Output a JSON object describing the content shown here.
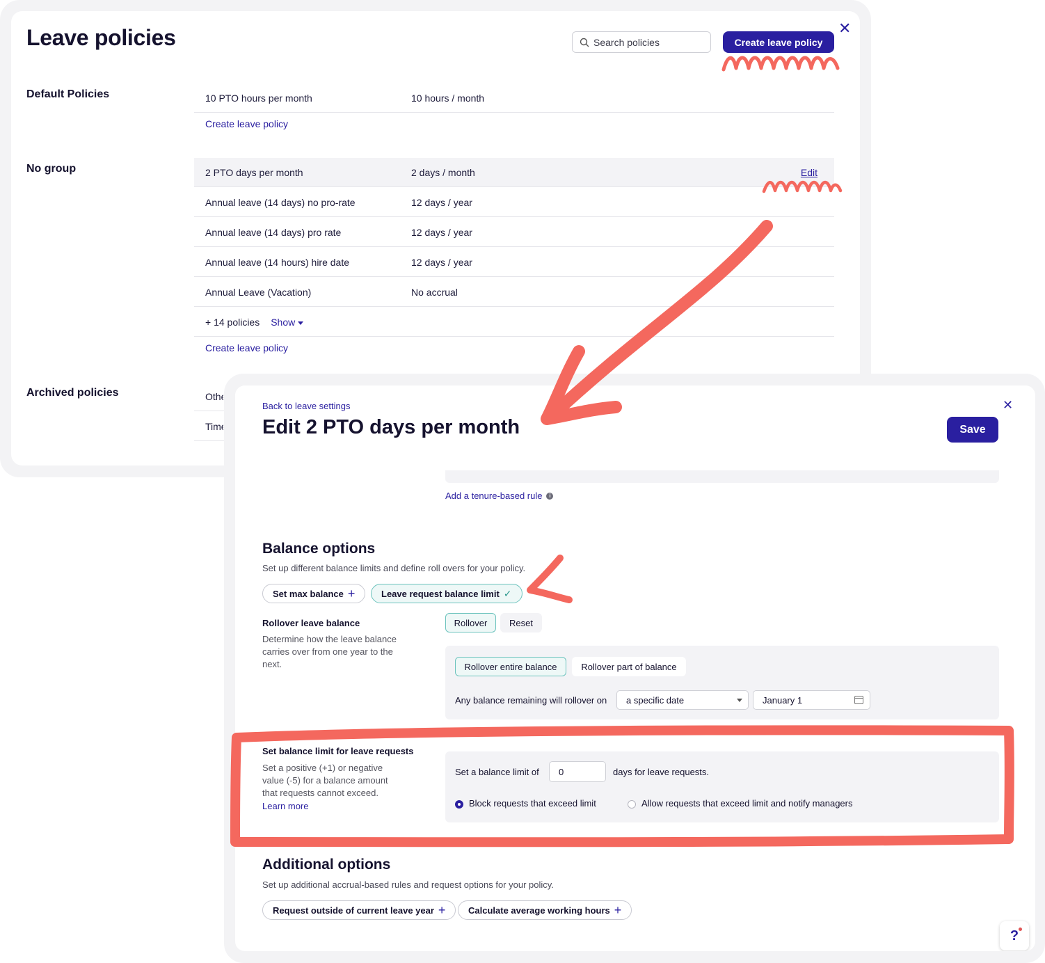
{
  "back_panel": {
    "title": "Leave policies",
    "search": {
      "placeholder": "Search policies"
    },
    "create_button": "Create leave policy",
    "sections": {
      "default": {
        "label": "Default Policies",
        "rows": [
          {
            "name": "10 PTO hours per month",
            "value": "10 hours / month"
          }
        ],
        "create_link": "Create leave policy"
      },
      "no_group": {
        "label": "No group",
        "rows": [
          {
            "name": "2 PTO days per month",
            "value": "2 days / month",
            "action": "Edit"
          },
          {
            "name": "Annual leave (14 days) no pro-rate",
            "value": "12 days / year"
          },
          {
            "name": "Annual leave (14 days) pro rate",
            "value": "12 days / year"
          },
          {
            "name": "Annual leave (14 hours) hire date",
            "value": "12 days / year"
          },
          {
            "name": "Annual Leave (Vacation)",
            "value": "No accrual"
          }
        ],
        "more_count": "+ 14 policies",
        "show_label": "Show",
        "create_link": "Create leave policy"
      },
      "archived": {
        "label": "Archived policies",
        "rows": [
          {
            "name": "Othe"
          },
          {
            "name": "Time"
          }
        ]
      }
    }
  },
  "front_panel": {
    "back_link": "Back to leave settings",
    "title": "Edit 2 PTO days per month",
    "save_button": "Save",
    "tenure_link": "Add a tenure-based rule",
    "balance_options": {
      "heading": "Balance options",
      "description": "Set up different balance limits and define roll overs for your policy.",
      "chips": [
        {
          "label": "Set max balance",
          "state": "add"
        },
        {
          "label": "Leave request balance limit",
          "state": "selected"
        }
      ],
      "rollover": {
        "title": "Rollover leave balance",
        "description": "Determine how the leave balance carries over from one year to the next.",
        "mode_options": [
          "Rollover",
          "Reset"
        ],
        "mode_selected": "Rollover",
        "amount_options": [
          "Rollover entire balance",
          "Rollover part of balance"
        ],
        "amount_selected": "Rollover entire balance",
        "date_prompt": "Any balance remaining will rollover on",
        "date_type": "a specific date",
        "date_value": "January 1"
      },
      "limit": {
        "title": "Set balance limit for leave requests",
        "description": "Set a positive (+1) or negative value (-5) for a balance amount that requests cannot exceed.",
        "learn_more": "Learn more",
        "prefix": "Set a balance limit of",
        "value": "0",
        "suffix": "days for leave requests.",
        "options": [
          "Block requests that exceed limit",
          "Allow requests that exceed limit and notify managers"
        ],
        "selected_option": "Block requests that exceed limit"
      }
    },
    "additional_options": {
      "heading": "Additional options",
      "description": "Set up additional accrual-based rules and request options for your policy.",
      "chips": [
        "Request outside of current leave year",
        "Calculate average working hours"
      ]
    },
    "help_icon": "question-icon"
  },
  "colors": {
    "primary": "#2a1fa0",
    "accent_teal": "#6cc3bd",
    "annotation": "#f4685e",
    "panel_gray": "#f3f3f6"
  }
}
